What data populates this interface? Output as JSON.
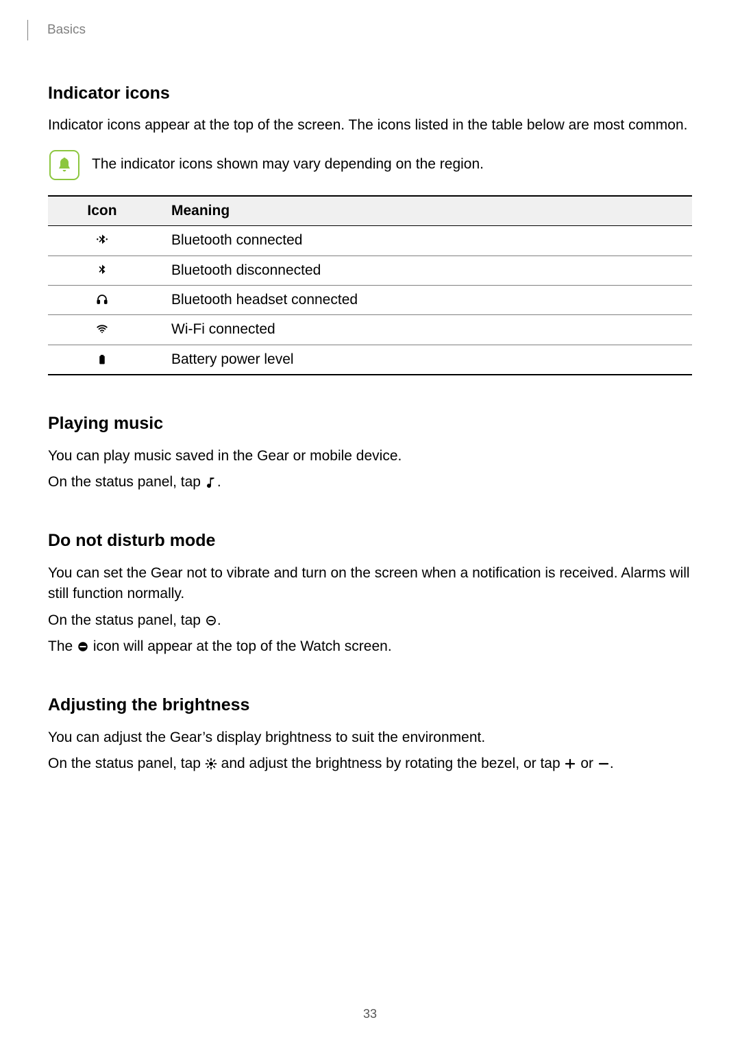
{
  "breadcrumb": "Basics",
  "page_number": "33",
  "indicator": {
    "heading": "Indicator icons",
    "intro": "Indicator icons appear at the top of the screen. The icons listed in the table below are most common.",
    "note": "The indicator icons shown may vary depending on the region.",
    "table": {
      "col_icon": "Icon",
      "col_meaning": "Meaning",
      "rows": [
        {
          "icon_name": "bluetooth-connected-icon",
          "meaning": "Bluetooth connected"
        },
        {
          "icon_name": "bluetooth-disconnected-icon",
          "meaning": "Bluetooth disconnected"
        },
        {
          "icon_name": "bluetooth-headset-icon",
          "meaning": "Bluetooth headset connected"
        },
        {
          "icon_name": "wifi-icon",
          "meaning": "Wi-Fi connected"
        },
        {
          "icon_name": "battery-icon",
          "meaning": "Battery power level"
        }
      ]
    }
  },
  "music": {
    "heading": "Playing music",
    "line1": "You can play music saved in the Gear or mobile device.",
    "line2a": "On the status panel, tap ",
    "line2b": "."
  },
  "dnd": {
    "heading": "Do not disturb mode",
    "line1": "You can set the Gear not to vibrate and turn on the screen when a notification is received. Alarms will still function normally.",
    "line2a": "On the status panel, tap ",
    "line2b": ".",
    "line3a": "The ",
    "line3b": " icon will appear at the top of the Watch screen."
  },
  "brightness": {
    "heading": "Adjusting the brightness",
    "line1": "You can adjust the Gear’s display brightness to suit the environment.",
    "line2a": "On the status panel, tap ",
    "line2b": " and adjust the brightness by rotating the bezel, or tap ",
    "line2c": " or ",
    "line2d": "."
  }
}
